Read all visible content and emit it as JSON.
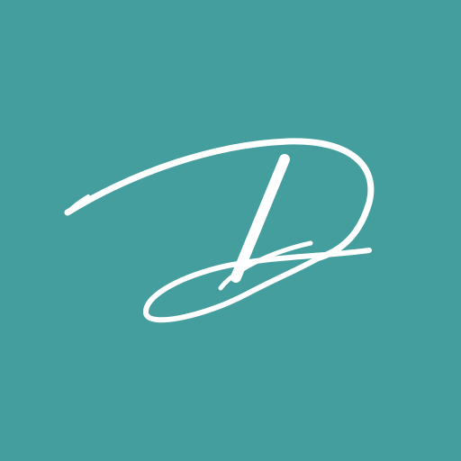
{
  "app_icon": {
    "name": "D monogram logo",
    "icon": "script-letter-d-logo",
    "colors": {
      "background": "#439e9d",
      "foreground": "#ffffff"
    }
  }
}
